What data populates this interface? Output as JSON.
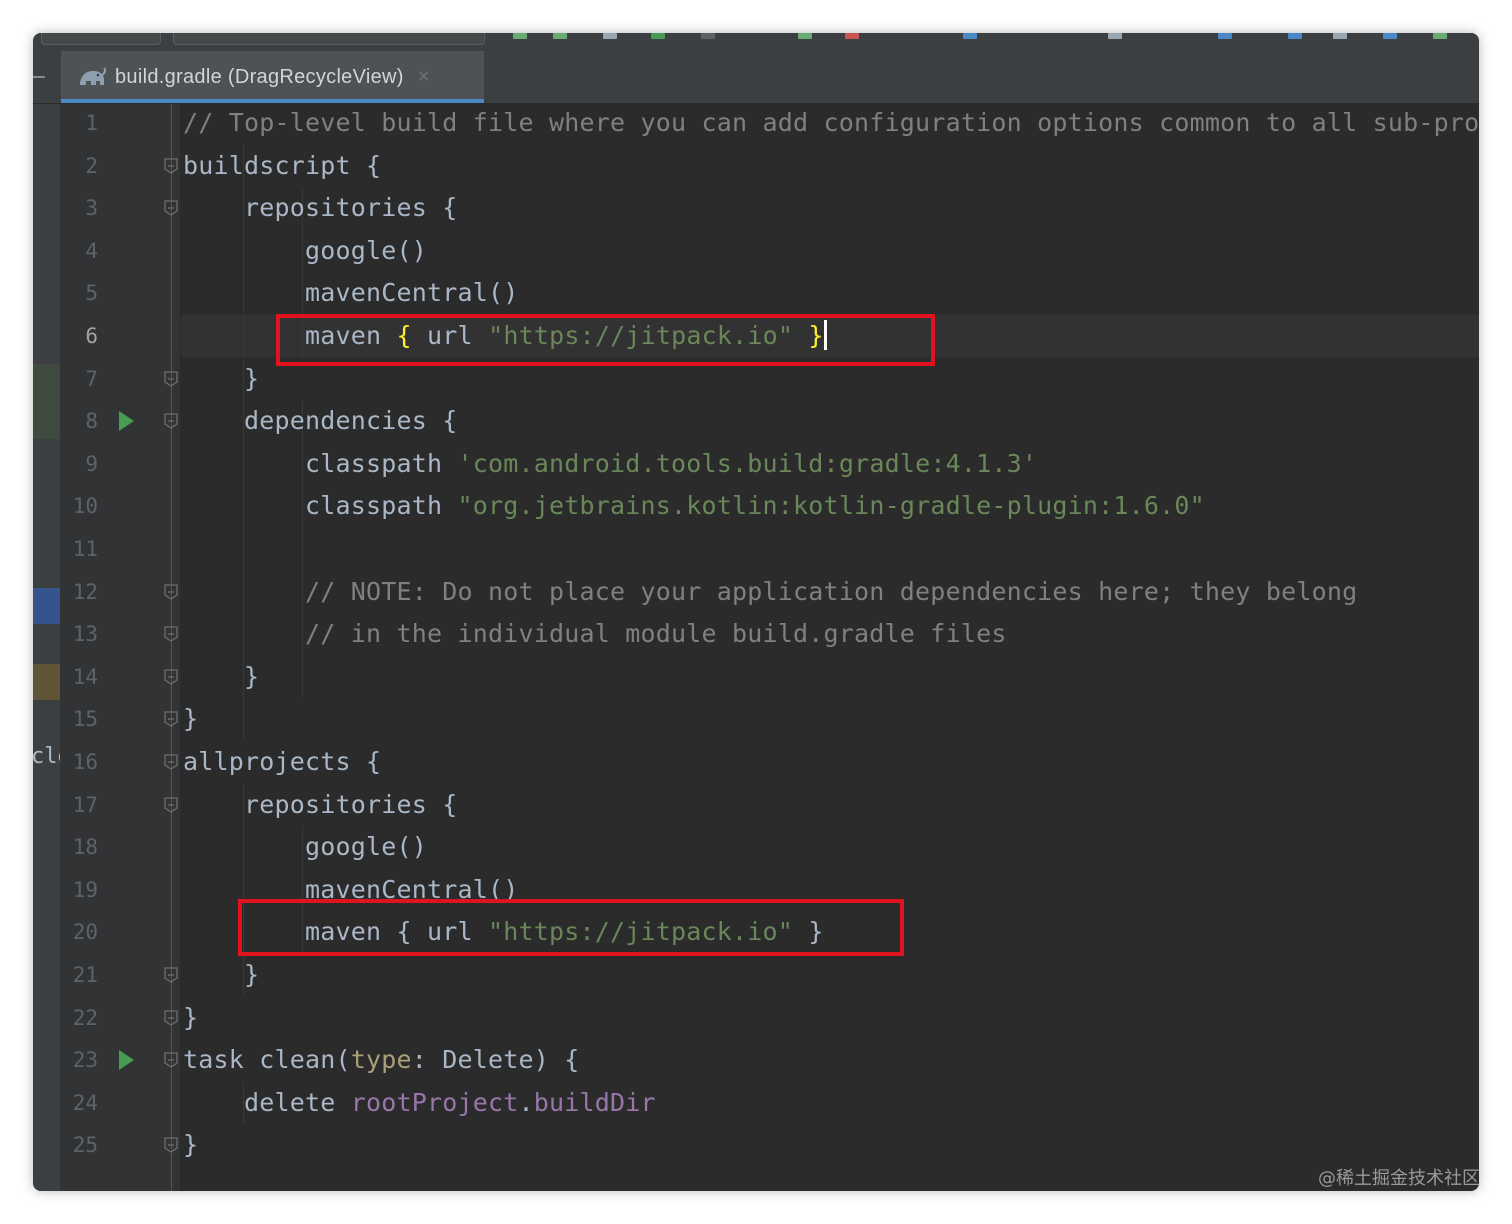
{
  "editor": {
    "tab": {
      "label": "build.gradle (DragRecycleView)",
      "close": "×",
      "icon": "gradle-elephant-icon"
    },
    "current_line": 6,
    "left_panel_fragment": "cle",
    "colors": {
      "background": "#2b2b2b",
      "comment": "#808080",
      "string": "#6a8759",
      "default": "#a9b7c6",
      "highlight_box": "#e0141e",
      "run_icon": "#499c54",
      "tab_accent": "#4a88c7"
    },
    "lines": [
      {
        "n": "1",
        "segments": [
          {
            "t": "// Top-level build file where you can add configuration options common to all sub-proje",
            "c": "comment"
          }
        ]
      },
      {
        "n": "2",
        "segments": [
          {
            "t": "buildscript {",
            "c": ""
          }
        ]
      },
      {
        "n": "3",
        "segments": [
          {
            "t": "    repositories {",
            "c": ""
          }
        ]
      },
      {
        "n": "4",
        "segments": [
          {
            "t": "        google()",
            "c": ""
          }
        ]
      },
      {
        "n": "5",
        "segments": [
          {
            "t": "        mavenCentral()",
            "c": ""
          }
        ]
      },
      {
        "n": "6",
        "segments": [
          {
            "t": "        maven ",
            "c": ""
          },
          {
            "t": "{",
            "c": "brace-hl"
          },
          {
            "t": " url ",
            "c": ""
          },
          {
            "t": "\"https://jitpack.io\"",
            "c": "string"
          },
          {
            "t": " ",
            "c": ""
          },
          {
            "t": "}",
            "c": "brace-hl"
          }
        ],
        "caret": true
      },
      {
        "n": "7",
        "segments": [
          {
            "t": "    }",
            "c": ""
          }
        ]
      },
      {
        "n": "8",
        "segments": [
          {
            "t": "    dependencies {",
            "c": ""
          }
        ]
      },
      {
        "n": "9",
        "segments": [
          {
            "t": "        classpath ",
            "c": ""
          },
          {
            "t": "'com.android.tools.build:gradle:4.1.3'",
            "c": "string"
          }
        ]
      },
      {
        "n": "10",
        "segments": [
          {
            "t": "        classpath ",
            "c": ""
          },
          {
            "t": "\"org.jetbrains.kotlin:kotlin-gradle-plugin:1.6.0\"",
            "c": "string"
          }
        ]
      },
      {
        "n": "11",
        "segments": []
      },
      {
        "n": "12",
        "segments": [
          {
            "t": "        // NOTE: Do not place your application dependencies here; they belong",
            "c": "comment"
          }
        ]
      },
      {
        "n": "13",
        "segments": [
          {
            "t": "        // in the individual module build.gradle files",
            "c": "comment"
          }
        ]
      },
      {
        "n": "14",
        "segments": [
          {
            "t": "    }",
            "c": ""
          }
        ]
      },
      {
        "n": "15",
        "segments": [
          {
            "t": "}",
            "c": ""
          }
        ]
      },
      {
        "n": "16",
        "segments": [
          {
            "t": "allprojects {",
            "c": ""
          }
        ]
      },
      {
        "n": "17",
        "segments": [
          {
            "t": "    repositories {",
            "c": ""
          }
        ]
      },
      {
        "n": "18",
        "segments": [
          {
            "t": "        google()",
            "c": ""
          }
        ]
      },
      {
        "n": "19",
        "segments": [
          {
            "t": "        mavenCentral()",
            "c": ""
          }
        ]
      },
      {
        "n": "20",
        "segments": [
          {
            "t": "        maven { url ",
            "c": ""
          },
          {
            "t": "\"https://jitpack.io\"",
            "c": "string"
          },
          {
            "t": " }",
            "c": ""
          }
        ]
      },
      {
        "n": "21",
        "segments": [
          {
            "t": "    }",
            "c": ""
          }
        ]
      },
      {
        "n": "22",
        "segments": [
          {
            "t": "}",
            "c": ""
          }
        ]
      },
      {
        "n": "23",
        "segments": [
          {
            "t": "task clean(",
            "c": ""
          },
          {
            "t": "type",
            "c": "param"
          },
          {
            "t": ": Delete) {",
            "c": ""
          }
        ]
      },
      {
        "n": "24",
        "segments": [
          {
            "t": "    delete ",
            "c": ""
          },
          {
            "t": "rootProject",
            "c": "prop"
          },
          {
            "t": ".",
            "c": ""
          },
          {
            "t": "buildDir",
            "c": "prop"
          }
        ]
      },
      {
        "n": "25",
        "segments": [
          {
            "t": "}",
            "c": ""
          }
        ]
      }
    ],
    "run_lines": [
      8,
      23
    ],
    "fold_lines": [
      2,
      3,
      7,
      8,
      12,
      13,
      14,
      15,
      16,
      17,
      21,
      22,
      23,
      25
    ],
    "highlighted_lines": [
      6,
      20
    ]
  },
  "watermark": "@稀土掘金技术社区"
}
